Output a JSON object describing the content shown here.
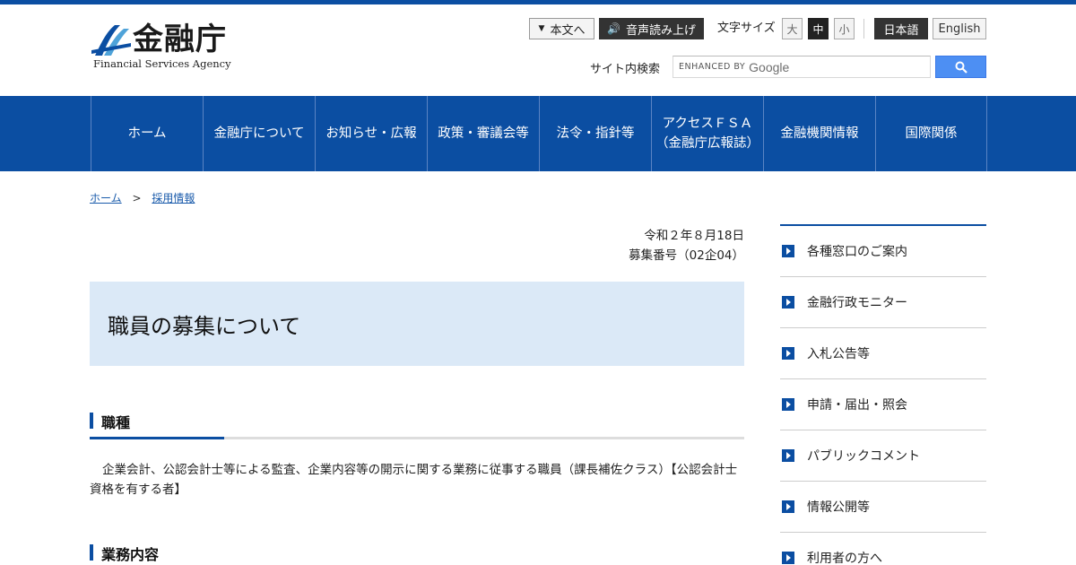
{
  "header": {
    "logo_jp": "金融庁",
    "logo_en": "Financial Services Agency",
    "skip_label": "本文へ",
    "voice_label": "音声読み上げ",
    "font_size_label": "文字サイズ",
    "font_sizes": [
      "大",
      "中",
      "小"
    ],
    "font_size_selected": "中",
    "lang_ja": "日本語",
    "lang_en": "English",
    "search_label": "サイト内検索",
    "search_enhanced": "ENHANCED BY",
    "search_brand": "Google"
  },
  "nav": {
    "items": [
      "ホーム",
      "金融庁について",
      "お知らせ・広報",
      "政策・審議会等",
      "法令・指針等",
      "アクセスＦＳＡ",
      "金融機関情報",
      "国際関係"
    ],
    "item5_sub": "（金融庁広報誌）"
  },
  "breadcrumb": {
    "home": "ホーム",
    "sep": ">",
    "current": "採用情報"
  },
  "main": {
    "date": "令和２年８月18日",
    "recruit_no": "募集番号（02企04）",
    "title": "職員の募集について",
    "section1_heading": "職種",
    "section1_body": "企業会計、公認会計士等による監査、企業内容等の開示に関する業務に従事する職員（課長補佐クラス）【公認会計士資格を有する者】",
    "section2_heading": "業務内容"
  },
  "sidebar": {
    "items": [
      "各種窓口のご案内",
      "金融行政モニター",
      "入札公告等",
      "申請・届出・照会",
      "パブリックコメント",
      "情報公開等",
      "利用者の方へ"
    ]
  },
  "colors": {
    "brand": "#0b4ea2",
    "title_bg": "#dbe9f7",
    "search_button": "#4d8ff3"
  }
}
